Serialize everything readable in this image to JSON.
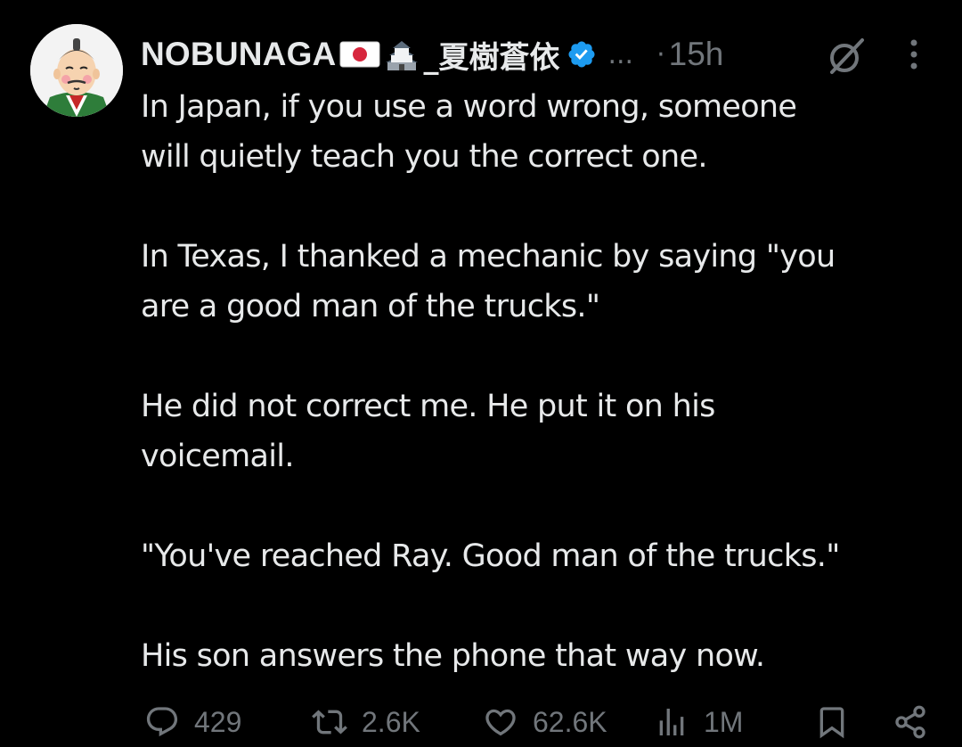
{
  "author": {
    "display_name": "NOBUNAGA",
    "name_suffix": "_夏樹蒼依",
    "flag_icon": "japan-flag-emoji",
    "castle_icon": "japanese-castle-emoji",
    "verified_icon": "verified-badge-icon",
    "verified_color": "#1d9bf0",
    "truncation": "...",
    "separator": "·",
    "time": "15h"
  },
  "tweet": {
    "paragraphs": [
      [
        "In Japan, if you use a word wrong, someone",
        "will quietly teach you the correct one."
      ],
      [
        "In Texas, I thanked a mechanic by saying \"you",
        "are a good man of the trucks.\""
      ],
      [
        "He did not correct me. He put it on his",
        "voicemail."
      ],
      [
        "\"You've reached Ray. Good man of the trucks.\""
      ],
      [
        "His son answers the phone that way now."
      ]
    ]
  },
  "actions": {
    "reply": {
      "icon": "reply-icon",
      "count": "429"
    },
    "retweet": {
      "icon": "retweet-icon",
      "count": "2.6K"
    },
    "like": {
      "icon": "heart-icon",
      "count": "62.6K"
    },
    "views": {
      "icon": "views-icon",
      "count": "1M"
    },
    "bookmark": {
      "icon": "bookmark-icon"
    },
    "share": {
      "icon": "share-icon"
    }
  },
  "colors": {
    "background": "#000000",
    "text": "#e7e9ea",
    "muted": "#71767b",
    "accent": "#1d9bf0"
  }
}
